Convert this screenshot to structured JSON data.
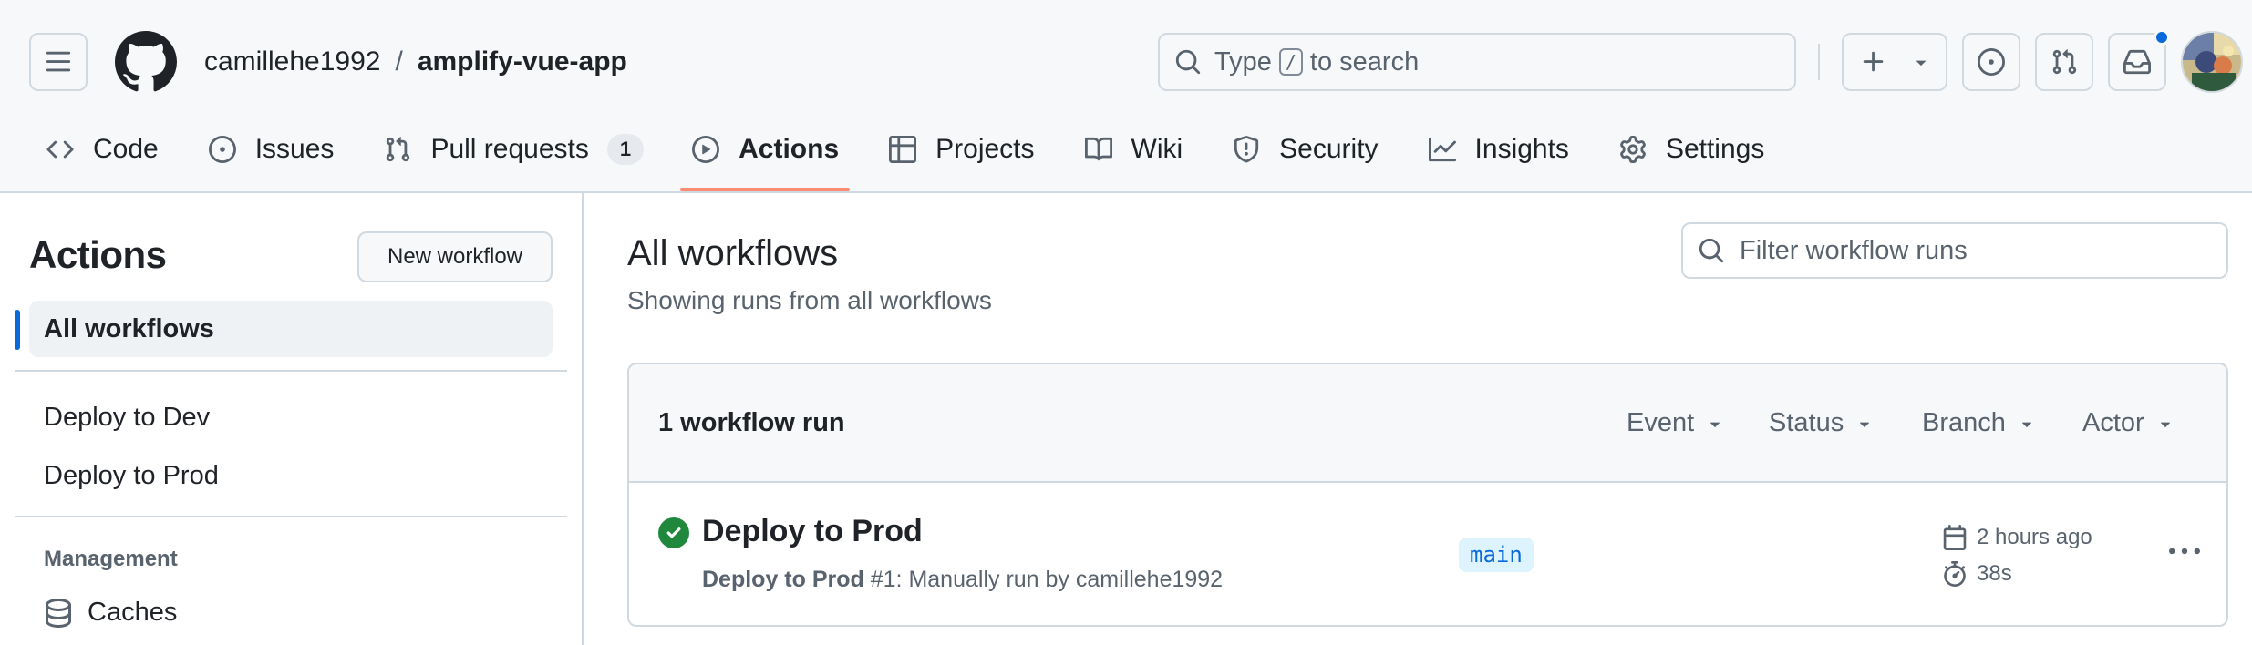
{
  "header": {
    "owner": "camillehe1992",
    "separator": "/",
    "repo": "amplify-vue-app",
    "search": {
      "prefix": "Type",
      "key": "/",
      "suffix": "to search"
    }
  },
  "tabs": [
    {
      "label": "Code",
      "icon": "code-icon"
    },
    {
      "label": "Issues",
      "icon": "issue-icon"
    },
    {
      "label": "Pull requests",
      "icon": "pull-request-icon",
      "count": "1"
    },
    {
      "label": "Actions",
      "icon": "play-icon",
      "active": true
    },
    {
      "label": "Projects",
      "icon": "table-icon"
    },
    {
      "label": "Wiki",
      "icon": "book-icon"
    },
    {
      "label": "Security",
      "icon": "shield-icon"
    },
    {
      "label": "Insights",
      "icon": "graph-icon"
    },
    {
      "label": "Settings",
      "icon": "gear-icon"
    }
  ],
  "sidebar": {
    "title": "Actions",
    "new_workflow": "New workflow",
    "all_workflows": "All workflows",
    "workflows": [
      "Deploy to Dev",
      "Deploy to Prod"
    ],
    "management_heading": "Management",
    "caches": "Caches"
  },
  "main": {
    "title": "All workflows",
    "subtitle": "Showing runs from all workflows",
    "filter_placeholder": "Filter workflow runs",
    "run_count": "1 workflow run",
    "filters": [
      "Event",
      "Status",
      "Branch",
      "Actor"
    ]
  },
  "run": {
    "status": "success",
    "title": "Deploy to Prod",
    "workflow_name": "Deploy to Prod",
    "meta_rest": "#1: Manually run by camillehe1992",
    "branch": "main",
    "when": "2 hours ago",
    "duration": "38s"
  },
  "colors": {
    "accent_blue": "#0969da",
    "active_tab_underline": "#fd8c73",
    "success_green": "#1f883d",
    "header_bg": "#f6f8fa",
    "border": "#d1d9e0",
    "muted_text": "#59636e"
  }
}
